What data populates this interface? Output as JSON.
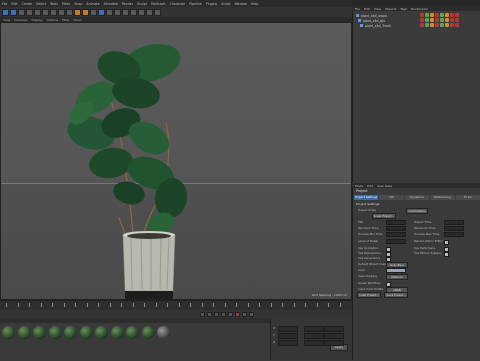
{
  "menu": {
    "items": [
      "File",
      "Edit",
      "Create",
      "Select",
      "Tools",
      "Mesh",
      "Snap",
      "Animate",
      "Simulate",
      "Render",
      "Sculpt",
      "MoGraph",
      "Character",
      "Pipeline",
      "Plugins",
      "Script",
      "Window",
      "Help"
    ]
  },
  "viewport_tabs": [
    "View",
    "Cameras",
    "Display",
    "Options",
    "Filter",
    "Panel"
  ],
  "viewport": {
    "status": "Grid Spacing : 1000 cm"
  },
  "object_manager": {
    "menu": [
      "File",
      "Edit",
      "View",
      "Objects",
      "Tags",
      "Bookmarks"
    ],
    "rows": [
      {
        "name": "plant_c4d_wood"
      },
      {
        "name": "plant_c4d_gfx"
      },
      {
        "name": "plant_c4d_Trunk"
      }
    ]
  },
  "attribute_manager": {
    "menu": [
      "Mode",
      "Edit",
      "User Data"
    ],
    "title": "Project",
    "tabs": [
      "Project Settings",
      "Info",
      "Dynamics",
      "Referencing",
      "To Do"
    ],
    "section": "Project Settings",
    "fields_left": [
      "Project Scale",
      "FPS",
      "Minimum Time",
      "Preview Min Time",
      "Level of Detail",
      "Use Animation",
      "Use Expressions",
      "Use Generators",
      "Default Object Color",
      "Color",
      "View Clipping",
      "Linear Workflow",
      "Input Color Profile"
    ],
    "fields_right": [
      "Project Time",
      "Maximum Time",
      "Preview Max Time",
      "Render LOD in Editor",
      "Use Deformers",
      "Use Motion System"
    ],
    "buttons": [
      "Scale Project...",
      "Load Preset...",
      "Save Preset..."
    ],
    "dropdowns": {
      "scale_unit": "Centimeters",
      "object_color": "Gray-Blue",
      "view_clipping": "Medium",
      "color_profile": "sRGB"
    }
  },
  "coordinates": {
    "labels": [
      "X",
      "Y",
      "Z"
    ],
    "apply": "Apply"
  },
  "colors": {
    "accent": "#3a6aa8",
    "leaf": "#1e4a2a",
    "pot": "#b8b8b0"
  }
}
